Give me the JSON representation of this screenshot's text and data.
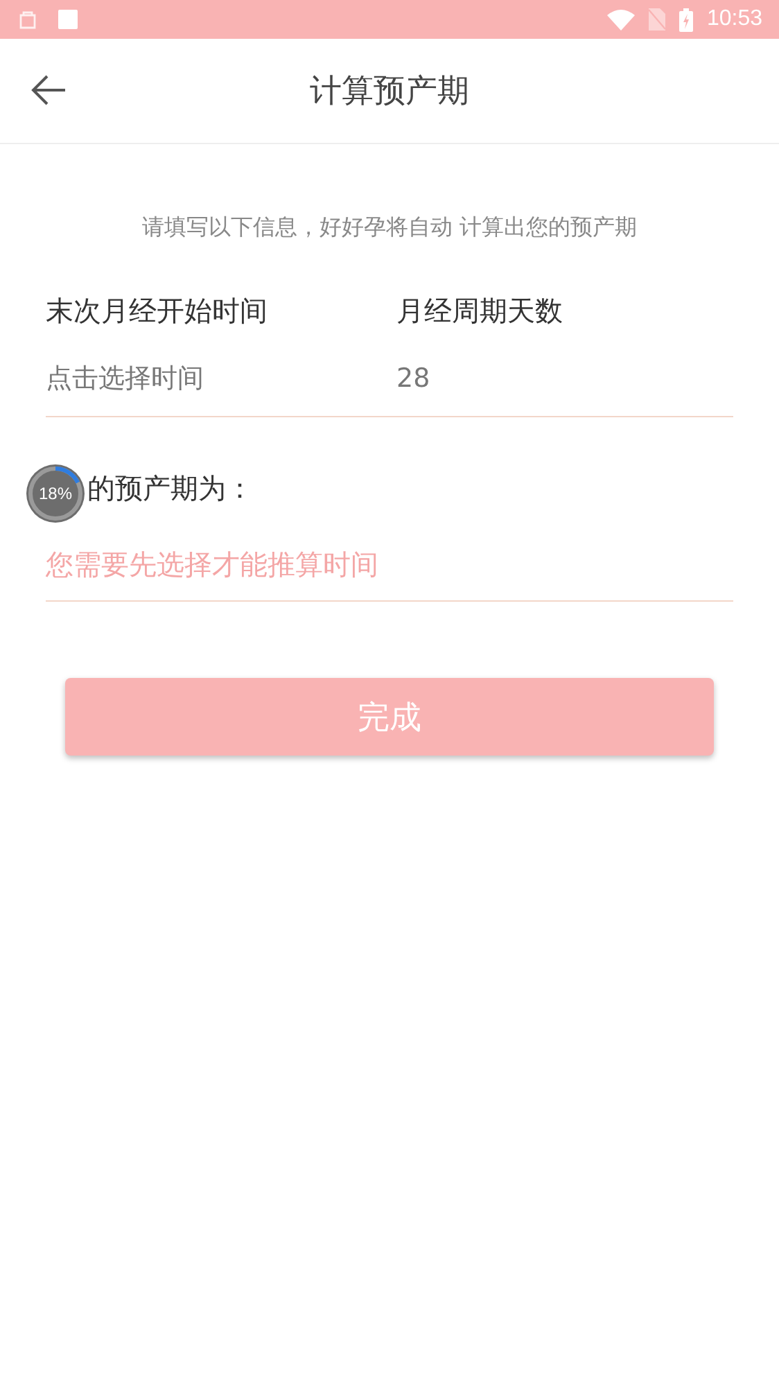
{
  "status_bar": {
    "time": "10:53"
  },
  "header": {
    "title": "计算预产期"
  },
  "hint": "请填写以下信息，好好孕将自动 计算出您的预产期",
  "fields": [
    {
      "label": "末次月经开始时间",
      "placeholder": "点击选择时间"
    },
    {
      "label": "月经周期天数",
      "value": "28"
    }
  ],
  "result": {
    "label": "的预产期为：",
    "message": "您需要先选择才能推算时间"
  },
  "floating_widget": {
    "text": "18%"
  },
  "button": "完成"
}
